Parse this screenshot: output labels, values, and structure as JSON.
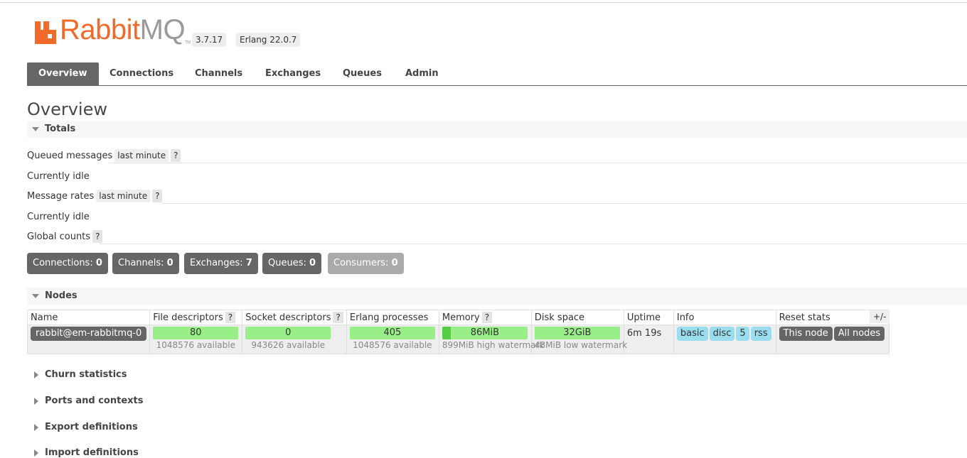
{
  "header": {
    "logo_rabbit": "Rabbit",
    "logo_mq": "MQ",
    "logo_tm": "TM",
    "version": "3.7.17",
    "erlang": "Erlang 22.0.7"
  },
  "tabs": [
    "Overview",
    "Connections",
    "Channels",
    "Exchanges",
    "Queues",
    "Admin"
  ],
  "page_title": "Overview",
  "totals": {
    "heading": "Totals",
    "queued_label": "Queued messages",
    "queued_range": "last minute",
    "help": "?",
    "queued_status": "Currently idle",
    "rates_label": "Message rates",
    "rates_range": "last minute",
    "rates_status": "Currently idle",
    "global_label": "Global counts"
  },
  "counts": [
    {
      "label": "Connections:",
      "value": "0"
    },
    {
      "label": "Channels:",
      "value": "0"
    },
    {
      "label": "Exchanges:",
      "value": "7"
    },
    {
      "label": "Queues:",
      "value": "0"
    },
    {
      "label": "Consumers:",
      "value": "0"
    }
  ],
  "nodes": {
    "heading": "Nodes",
    "columns": [
      "Name",
      "File descriptors",
      "Socket descriptors",
      "Erlang processes",
      "Memory",
      "Disk space",
      "Uptime",
      "Info",
      "Reset stats"
    ],
    "plus_minus": "+/-",
    "row": {
      "name": "rabbit@em-rabbitmq-0",
      "fd_used": "80",
      "fd_avail": "1048576 available",
      "sock_used": "0",
      "sock_avail": "943626 available",
      "proc_used": "405",
      "proc_avail": "1048576 available",
      "mem_used": "86MiB",
      "mem_fraction": 0.096,
      "mem_watermark": "899MiB high watermark",
      "disk_free": "32GiB",
      "disk_watermark": "48MiB low watermark",
      "uptime": "6m 19s",
      "info": [
        "basic",
        "disc",
        "5",
        "rss"
      ],
      "reset": [
        "This node",
        "All nodes"
      ]
    }
  },
  "collapsed_sections": [
    "Churn statistics",
    "Ports and contexts",
    "Export definitions",
    "Import definitions"
  ],
  "colors": {
    "brand_orange": "#f26a2a",
    "tab_active": "#666666",
    "bar_green": "#99ee88",
    "info_blue": "#99ddee"
  }
}
